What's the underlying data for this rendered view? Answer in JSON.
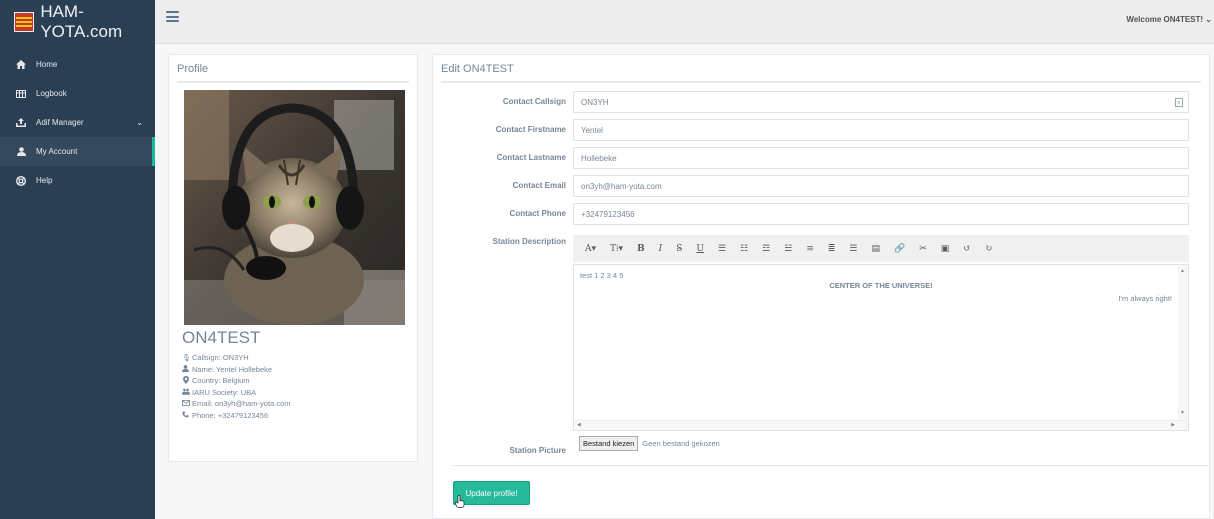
{
  "brand": {
    "title": "HAM-YOTA.com",
    "logo_icon": "yota-logo-icon"
  },
  "sidebar": {
    "items": [
      {
        "label": "Home",
        "icon": "home-icon"
      },
      {
        "label": "Logbook",
        "icon": "table-icon"
      },
      {
        "label": "Adif Manager",
        "icon": "upload-icon"
      },
      {
        "label": "My Account",
        "icon": "user-icon",
        "active": true
      },
      {
        "label": "Help",
        "icon": "lifebuoy-icon"
      }
    ]
  },
  "topbar": {
    "welcome": "Welcome ON4TEST! ⌄"
  },
  "profile": {
    "title": "Profile",
    "name": "ON4TEST",
    "details": [
      {
        "icon": "microphone-icon",
        "text": "Callsign: ON3YH"
      },
      {
        "icon": "user-icon",
        "text": "Name: Yentel Hollebeke"
      },
      {
        "icon": "map-marker-icon",
        "text": "Country: Belgium"
      },
      {
        "icon": "group-icon",
        "text": "IARU Society: UBA"
      },
      {
        "icon": "envelope-icon",
        "text": "Email: on3yh@ham-yota.com"
      },
      {
        "icon": "phone-icon",
        "text": "Phone: +32479123456"
      }
    ]
  },
  "edit": {
    "title": "Edit ON4TEST",
    "fields": [
      {
        "label": "Contact Callsign",
        "value": "ON3YH"
      },
      {
        "label": "Contact Firstname",
        "value": "Yentel"
      },
      {
        "label": "Contact Lastname",
        "value": "Hollebeke"
      },
      {
        "label": "Contact Email",
        "value": "on3yh@ham-yota.com"
      },
      {
        "label": "Contact Phone",
        "value": "+32479123456"
      }
    ],
    "description_label": "Station Description",
    "toolbar": [
      "A▾",
      "T⁞▾",
      "B",
      "I",
      "S̶",
      "U",
      "☰",
      "☷",
      "☲",
      "☱",
      "≡",
      "≣",
      "☰",
      "▤",
      "🔗",
      "✂",
      "▣",
      "↺",
      "↻"
    ],
    "editor": {
      "line1": "test 1 2 3 4 5",
      "center": "CENTER OF THE UNIVERSE!",
      "right": "I'm always right!"
    },
    "picture_label": "Station Picture",
    "file_button": "Bestand kiezen",
    "file_status": "Geen bestand gekozen",
    "submit": "Update profile!"
  }
}
